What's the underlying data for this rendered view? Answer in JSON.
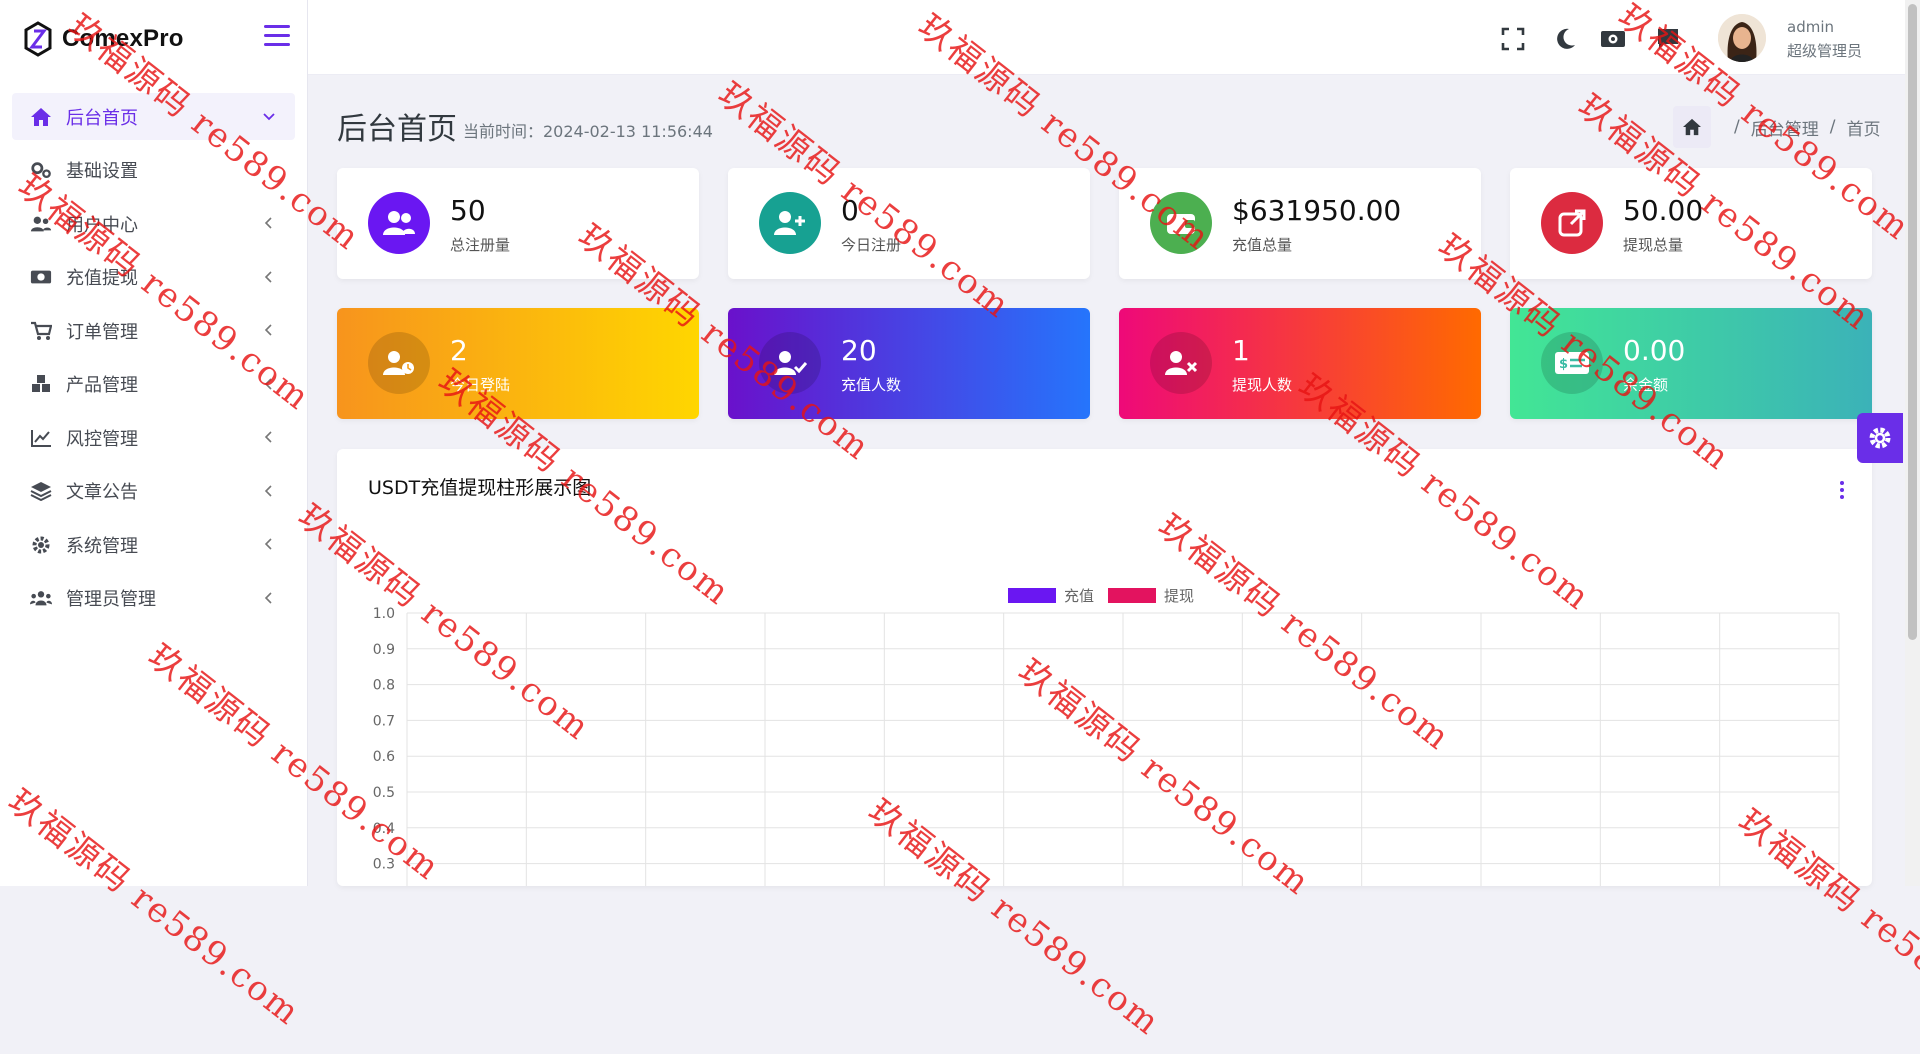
{
  "brand": {
    "name": "ComexPro"
  },
  "sidebar": {
    "items": [
      {
        "label": "后台首页",
        "icon": "home-icon",
        "active": true
      },
      {
        "label": "基础设置",
        "icon": "gears-icon"
      },
      {
        "label": "用户中心",
        "icon": "users-icon"
      },
      {
        "label": "充值提现",
        "icon": "money-bill-icon"
      },
      {
        "label": "订单管理",
        "icon": "cart-icon"
      },
      {
        "label": "产品管理",
        "icon": "cubes-icon"
      },
      {
        "label": "风控管理",
        "icon": "chart-line-icon"
      },
      {
        "label": "文章公告",
        "icon": "layers-icon"
      },
      {
        "label": "系统管理",
        "icon": "gear-icon"
      },
      {
        "label": "管理员管理",
        "icon": "user-group-icon"
      }
    ]
  },
  "topbar": {
    "icons": [
      "fullscreen-icon",
      "moon-icon",
      "money-icon",
      "message-icon"
    ],
    "user": {
      "name": "admin",
      "role": "超级管理员"
    }
  },
  "page": {
    "title": "后台首页",
    "time": "当前时间：2024-02-13 11:56:44",
    "breadcrumb": [
      "后台管理",
      "首页"
    ]
  },
  "stats": [
    {
      "value": "50",
      "label": "总注册量",
      "icon": "users-icon",
      "color": "#6a17f2"
    },
    {
      "value": "0",
      "label": "今日注册",
      "icon": "user-plus-icon",
      "color": "#17a192"
    },
    {
      "value": "$631950.00",
      "label": "充值总量",
      "icon": "wallet-icon",
      "color": "#4caf50"
    },
    {
      "value": "50.00",
      "label": "提现总量",
      "icon": "external-link-icon",
      "color": "#dc2b40"
    },
    {
      "value": "2",
      "label": "今日登陆",
      "icon": "user-clock-icon",
      "gradient": [
        "#f7941d",
        "#ffd600"
      ]
    },
    {
      "value": "20",
      "label": "充值人数",
      "icon": "user-check-icon",
      "gradient": [
        "#6a11cb",
        "#2575fc"
      ]
    },
    {
      "value": "1",
      "label": "提现人数",
      "icon": "user-times-icon",
      "gradient": [
        "#ee0979",
        "#ff6a00"
      ]
    },
    {
      "value": "0.00",
      "label": "余金额",
      "icon": "money-check-icon",
      "gradient": [
        "#42e695",
        "#3bb2b8"
      ]
    }
  ],
  "chart_panel": {
    "title": "USDT充值提现柱形展示图"
  },
  "chart_data": {
    "type": "bar",
    "title": "USDT充值提现柱形展示图",
    "series": [
      {
        "name": "充值",
        "color": "#6a17f2",
        "values": []
      },
      {
        "name": "提现",
        "color": "#e3135f",
        "values": []
      }
    ],
    "yticks": [
      "1.0",
      "0.9",
      "0.8",
      "0.7",
      "0.6",
      "0.5",
      "0.4",
      "0.3"
    ],
    "ylim": [
      0,
      1
    ],
    "grid": true,
    "legend": "top-center"
  },
  "watermark": [
    "玖福源码 re589.com"
  ]
}
